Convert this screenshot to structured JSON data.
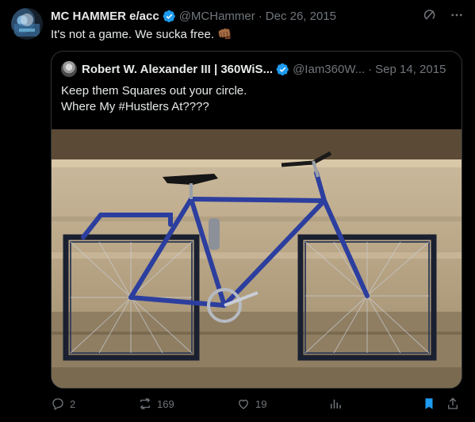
{
  "tweet": {
    "name": "MC HAMMER e/acc",
    "handle": "@MCHammer",
    "date": "Dec 26, 2015",
    "text": "It's not a game. We sucka free. 👊🏾"
  },
  "quote": {
    "name": "Robert W. Alexander III | 360WiS...",
    "handle": "@Iam360W...",
    "date": "Sep 14, 2015",
    "line1": "Keep them Squares out your circle.",
    "line2": "Where My #Hustlers At????"
  },
  "actions": {
    "replies": "2",
    "reposts": "169",
    "likes": "19"
  },
  "icons": {
    "verified": "verified-badge-icon",
    "grok": "grok-icon",
    "more": "more-icon",
    "reply": "reply-icon",
    "repost": "repost-icon",
    "like": "heart-icon",
    "views": "analytics-icon",
    "bookmark": "bookmark-icon",
    "share": "share-icon"
  },
  "colors": {
    "accent": "#1d9bf0",
    "muted": "#71767b",
    "text": "#e7e9ea",
    "background": "#000000"
  }
}
